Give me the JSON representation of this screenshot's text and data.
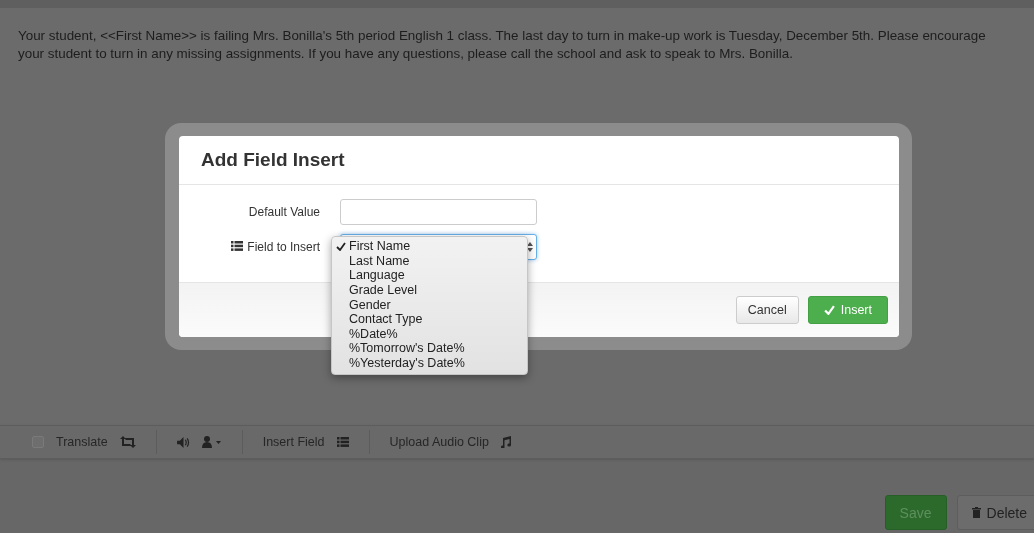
{
  "message": {
    "text": "Your student, <<First Name>> is failing Mrs. Bonilla's 5th period English 1 class. The last day to turn in make-up work is Tuesday, December 5th. Please encourage your student to turn in any missing assignments. If you have any questions, please call the school and ask to speak to Mrs. Bonilla."
  },
  "toolbar": {
    "translate": {
      "label": "Translate",
      "checked": false
    },
    "insert_field": {
      "label": "Insert Field"
    },
    "upload_audio": {
      "label": "Upload Audio Clip"
    }
  },
  "actions": [
    {
      "label": "Save",
      "kind": "primary"
    },
    {
      "label": "Delete",
      "kind": "default"
    }
  ],
  "dialog": {
    "title": "Add Field Insert",
    "default_value": {
      "label": "Default Value"
    },
    "field_to_insert": {
      "label": "Field to Insert",
      "expanded": true,
      "options": [
        {
          "label": "First Name",
          "selected": true
        },
        {
          "label": "Last Name",
          "selected": false
        },
        {
          "label": "Language",
          "selected": false
        },
        {
          "label": "Grade Level",
          "selected": false
        },
        {
          "label": "Gender",
          "selected": false
        },
        {
          "label": "Contact Type",
          "selected": false
        },
        {
          "label": "%Date%",
          "selected": false
        },
        {
          "label": "%Tomorrow's Date%",
          "selected": false
        },
        {
          "label": "%Yesterday's Date%",
          "selected": false
        }
      ]
    },
    "buttons": [
      {
        "label": "Cancel",
        "kind": "default"
      },
      {
        "label": "Insert",
        "kind": "primary"
      }
    ]
  }
}
